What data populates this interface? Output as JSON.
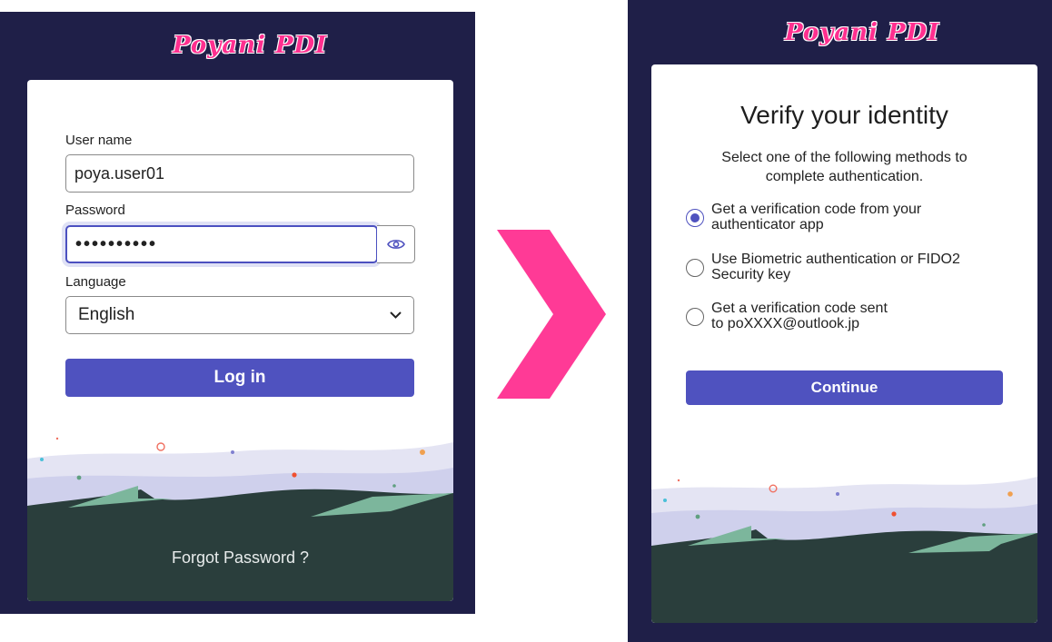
{
  "brand": {
    "logo_text": "Poyani PDI",
    "accent_color": "#ff2f8f",
    "primary_color": "#4f52bf"
  },
  "login": {
    "username_label": "User name",
    "username_value": "poya.user01",
    "password_label": "Password",
    "password_value": "••••••••••",
    "show_password_icon": "eye-icon",
    "language_label": "Language",
    "language_selected": "English",
    "login_button": "Log in",
    "forgot_password": "Forgot Password ?"
  },
  "verify": {
    "title": "Verify your identity",
    "subtitle_line1": "Select one of the following methods to",
    "subtitle_line2": "complete authentication.",
    "options": [
      {
        "line1": "Get a verification code from your",
        "line2": "authenticator app",
        "checked": true
      },
      {
        "line1": "Use Biometric authentication or FIDO2",
        "line2": "Security key",
        "checked": false
      },
      {
        "line1": "Get a verification code sent",
        "line2": "to poXXXX@outlook.jp",
        "checked": false
      }
    ],
    "continue_button": "Continue"
  }
}
